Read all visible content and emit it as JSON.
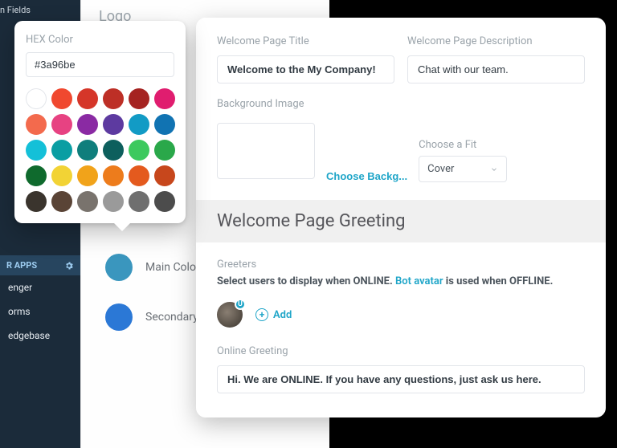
{
  "sidebar": {
    "fields_fragment": "n Fields",
    "apps_header": "R APPS",
    "items": [
      "enger",
      "orms",
      "edgebase"
    ]
  },
  "mid": {
    "logo_label": "Logo",
    "main_color_label": "Main Color",
    "secondary_label": "Secondary B",
    "main_color": "#3a96be",
    "secondary_color": "#2b78d6"
  },
  "popover": {
    "title": "HEX Color",
    "hex_value": "#3a96be",
    "swatches": [
      "#ffffff",
      "#f0482f",
      "#d53629",
      "#bd2f26",
      "#a52321",
      "#e01d6f",
      "#f36a4d",
      "#e74282",
      "#8a2aa3",
      "#5d3aa0",
      "#129bc5",
      "#1173b2",
      "#14c0d8",
      "#0a9ea3",
      "#0f7e7c",
      "#0d5f5d",
      "#3cc95e",
      "#2aa84a",
      "#0f6a2d",
      "#f2d335",
      "#f1a31a",
      "#ed7c1c",
      "#e45a1e",
      "#c7471c",
      "#3a342d",
      "#5a4436",
      "#79736d",
      "#9a9a9a",
      "#6f6f6f",
      "#4c4c4c"
    ]
  },
  "main": {
    "welcome_title_label": "Welcome Page Title",
    "welcome_title_value": "Welcome to the My Company!",
    "welcome_desc_label": "Welcome Page Description",
    "welcome_desc_value": "Chat with our team.",
    "bg_label": "Background Image",
    "choose_bg": "Choose Backg...",
    "fit_label": "Choose a Fit",
    "fit_value": "Cover",
    "greeting_header": "Welcome Page Greeting",
    "greeters_label": "Greeters",
    "greeters_desc_bold": "Select users to display when ONLINE.",
    "greeters_desc_link": "Bot avatar",
    "greeters_desc_rest": "is used when OFFLINE.",
    "avatar_badge": "U",
    "add_label": "Add",
    "online_greeting_label": "Online Greeting",
    "online_greeting_value": "Hi. We are ONLINE. If you have any questions, just ask us here."
  }
}
